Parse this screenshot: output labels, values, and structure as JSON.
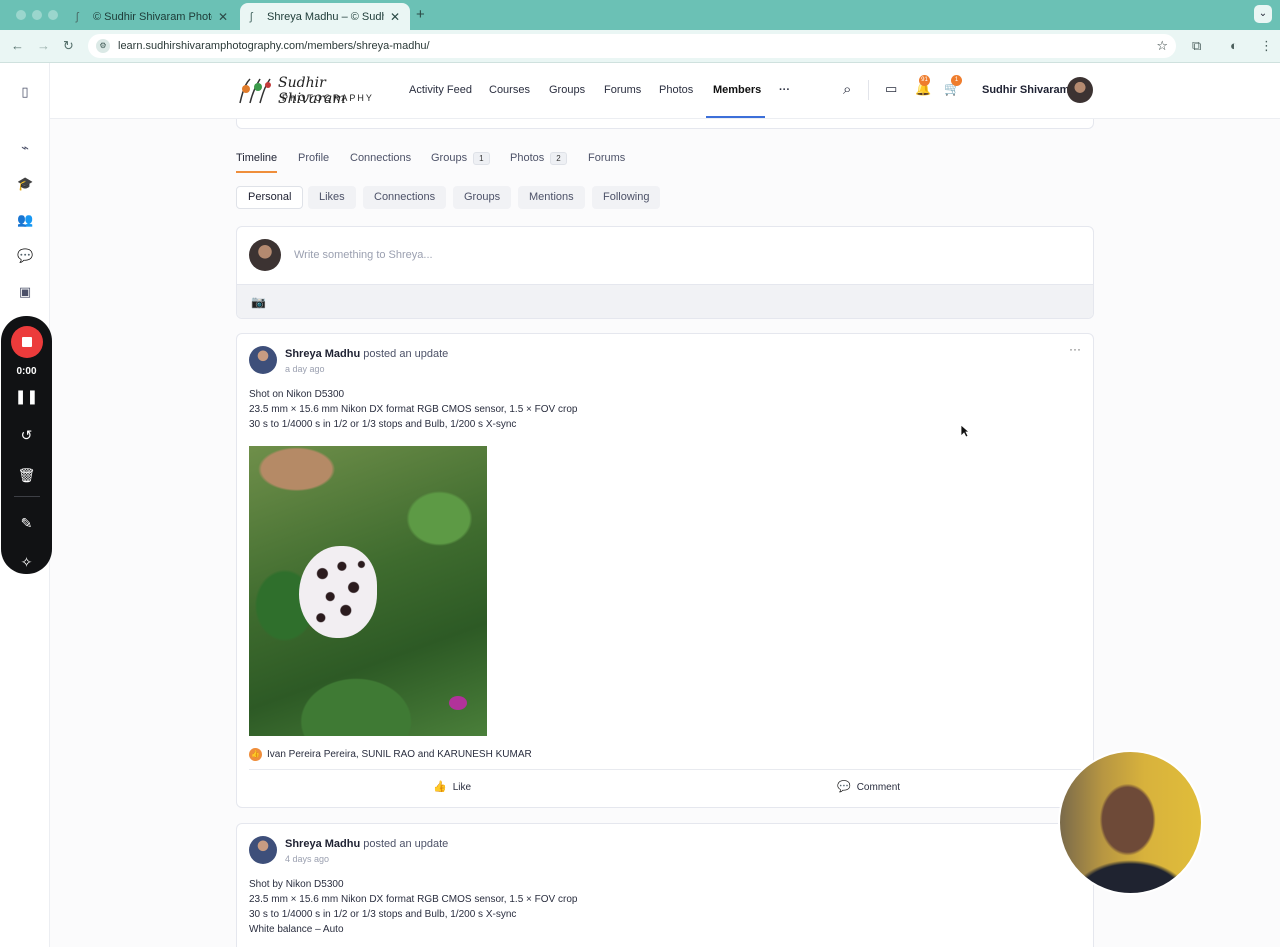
{
  "browser": {
    "tabs": [
      {
        "title": "© Sudhir Shivaram Photograp",
        "active": false
      },
      {
        "title": "Shreya Madhu – © Sudhir Shi",
        "active": true
      }
    ],
    "url": "learn.sudhirshivaramphotography.com/members/shreya-madhu/"
  },
  "recorder": {
    "time": "0:00"
  },
  "site": {
    "logo_script": "Sudhir Shivaram",
    "logo_text": "PHOTOGRAPHY",
    "menu": [
      "Activity Feed",
      "Courses",
      "Groups",
      "Forums",
      "Photos",
      "Members"
    ],
    "active_menu": "Members",
    "more": "···",
    "badges": {
      "notifications": "91",
      "cart": "1"
    },
    "user_name": "Sudhir Shivaram"
  },
  "profile_nav": {
    "tabs": [
      {
        "label": "Timeline"
      },
      {
        "label": "Profile"
      },
      {
        "label": "Connections"
      },
      {
        "label": "Groups",
        "count": "1"
      },
      {
        "label": "Photos",
        "count": "2"
      },
      {
        "label": "Forums"
      }
    ],
    "active": "Timeline",
    "filters": [
      "Personal",
      "Likes",
      "Connections",
      "Groups",
      "Mentions",
      "Following"
    ],
    "active_filter": "Personal"
  },
  "composer": {
    "placeholder": "Write something to Shreya..."
  },
  "posts": [
    {
      "author": "Shreya Madhu",
      "action": "posted an update",
      "time": "a day ago",
      "lines": [
        "Shot on Nikon D5300",
        "23.5 mm × 15.6 mm Nikon DX format RGB CMOS sensor, 1.5 × FOV crop",
        "30 s to 1/4000 s in 1/2 or 1/3 stops and Bulb, 1/200 s X-sync"
      ],
      "reactions": "Ivan Pereira Pereira, SUNIL RAO and KARUNESH KUMAR",
      "like_label": "Like",
      "comment_label": "Comment"
    },
    {
      "author": "Shreya Madhu",
      "action": "posted an update",
      "time": "4 days ago",
      "lines": [
        "Shot by Nikon D5300",
        "23.5 mm × 15.6 mm Nikon DX format RGB CMOS sensor, 1.5 × FOV crop",
        "30 s to 1/4000 s in 1/2 or 1/3 stops and Bulb, 1/200 s X-sync",
        "White balance – Auto"
      ]
    }
  ],
  "colors": {
    "accent_orange": "#ef8e3b",
    "menu_underline": "#3c6fd9",
    "tabbar": "#6bc1b5",
    "record_red": "#ec3b3b"
  }
}
